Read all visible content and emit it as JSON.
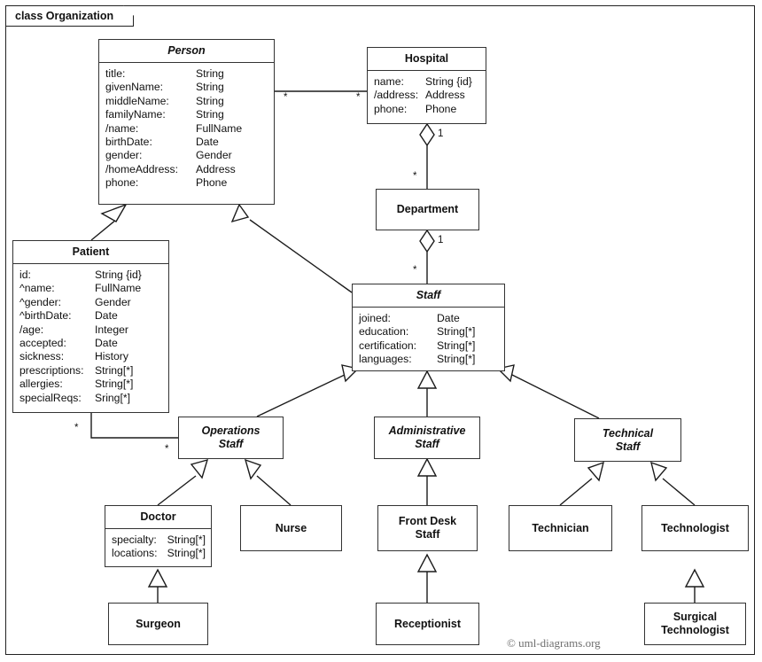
{
  "frame": {
    "label": "class Organization"
  },
  "credit": "© uml-diagrams.org",
  "classes": {
    "person": {
      "name": "Person",
      "attrs": [
        {
          "name": "title:",
          "type": "String"
        },
        {
          "name": "givenName:",
          "type": "String"
        },
        {
          "name": "middleName:",
          "type": "String"
        },
        {
          "name": "familyName:",
          "type": "String"
        },
        {
          "name": "/name:",
          "type": "FullName"
        },
        {
          "name": "birthDate:",
          "type": "Date"
        },
        {
          "name": "gender:",
          "type": "Gender"
        },
        {
          "name": "/homeAddress:",
          "type": "Address"
        },
        {
          "name": "phone:",
          "type": "Phone"
        }
      ]
    },
    "hospital": {
      "name": "Hospital",
      "attrs": [
        {
          "name": "name:",
          "type": "String {id}"
        },
        {
          "name": "/address:",
          "type": "Address"
        },
        {
          "name": "phone:",
          "type": "Phone"
        }
      ]
    },
    "patient": {
      "name": "Patient",
      "attrs": [
        {
          "name": "id:",
          "type": "String {id}"
        },
        {
          "name": "^name:",
          "type": "FullName"
        },
        {
          "name": "^gender:",
          "type": "Gender"
        },
        {
          "name": "^birthDate:",
          "type": "Date"
        },
        {
          "name": "/age:",
          "type": "Integer"
        },
        {
          "name": "accepted:",
          "type": "Date"
        },
        {
          "name": "sickness:",
          "type": "History"
        },
        {
          "name": "prescriptions:",
          "type": "String[*]"
        },
        {
          "name": "allergies:",
          "type": "String[*]"
        },
        {
          "name": "specialReqs:",
          "type": "Sring[*]"
        }
      ]
    },
    "department": {
      "name": "Department"
    },
    "staff": {
      "name": "Staff",
      "attrs": [
        {
          "name": "joined:",
          "type": "Date"
        },
        {
          "name": "education:",
          "type": "String[*]"
        },
        {
          "name": "certification:",
          "type": "String[*]"
        },
        {
          "name": "languages:",
          "type": "String[*]"
        }
      ]
    },
    "operations_staff": {
      "name": "Operations\nStaff"
    },
    "administrative_staff": {
      "name": "Administrative\nStaff"
    },
    "technical_staff": {
      "name": "Technical\nStaff"
    },
    "doctor": {
      "name": "Doctor",
      "attrs": [
        {
          "name": "specialty:",
          "type": "String[*]"
        },
        {
          "name": "locations:",
          "type": "String[*]"
        }
      ]
    },
    "nurse": {
      "name": "Nurse"
    },
    "front_desk_staff": {
      "name": "Front Desk\nStaff"
    },
    "technician": {
      "name": "Technician"
    },
    "technologist": {
      "name": "Technologist"
    },
    "surgeon": {
      "name": "Surgeon"
    },
    "receptionist": {
      "name": "Receptionist"
    },
    "surgical_technologist": {
      "name": "Surgical\nTechnologist"
    }
  },
  "multiplicities": {
    "person_hospital_person_end": "*",
    "person_hospital_hospital_end": "*",
    "hospital_department_hospital_end": "1",
    "hospital_department_department_end": "*",
    "department_staff_department_end": "1",
    "department_staff_staff_end": "*",
    "patient_operations_patient_end": "*",
    "patient_operations_operations_end": "*"
  }
}
